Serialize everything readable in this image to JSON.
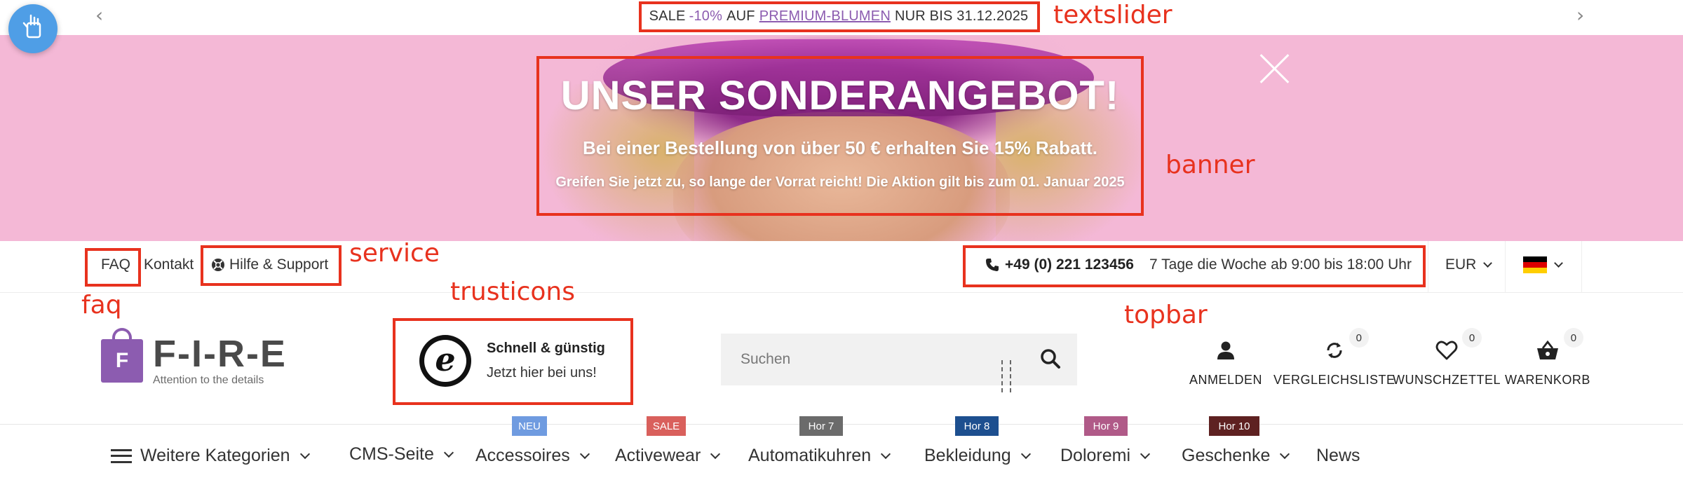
{
  "textslider": {
    "sale": "SALE",
    "percent": "-10%",
    "auf": "AUF",
    "link": "PREMIUM-BLUMEN",
    "suffix": "NUR BIS 31.12.2025"
  },
  "banner": {
    "title": "UNSER SONDERANGEBOT!",
    "subtitle": "Bei einer Bestellung von über 50 € erhalten Sie 15% Rabatt.",
    "note": "Greifen Sie jetzt zu, so lange der Vorrat reicht! Die Aktion gilt bis zum 01. Januar 2025"
  },
  "topbar": {
    "faq": "FAQ",
    "kontakt": "Kontakt",
    "support": "Hilfe & Support",
    "phone": "+49 (0) 221 123456",
    "hours": "7 Tage die Woche ab 9:00 bis 18:00 Uhr",
    "currency": "EUR"
  },
  "logo": {
    "letter": "F",
    "name": "F-I-R-E",
    "tagline": "Attention to the details"
  },
  "trust": {
    "title": "Schnell & günstig",
    "subtitle": "Jetzt hier bei uns!"
  },
  "search": {
    "placeholder": "Suchen"
  },
  "actions": {
    "login": "ANMELDEN",
    "compare": "VERGLEICHSLISTE",
    "compare_count": "0",
    "wishlist": "WUNSCHZETTEL",
    "wishlist_count": "0",
    "cart": "WARENKORB",
    "cart_count": "0"
  },
  "nav": {
    "more": "Weitere Kategorien",
    "cms": "CMS-Seite",
    "accessoires": "Accessoires",
    "activewear": "Activewear",
    "automatikuhren": "Automatikuhren",
    "bekleidung": "Bekleidung",
    "doloremi": "Doloremi",
    "geschenke": "Geschenke",
    "news": "News",
    "badges": {
      "accessoires": "NEU",
      "activewear": "SALE",
      "automatikuhren": "Hor 7",
      "bekleidung": "Hor 8",
      "doloremi": "Hor 9",
      "geschenke": "Hor 10"
    },
    "badge_colors": {
      "accessoires": "#6f9be0",
      "activewear": "#d9605c",
      "automatikuhren": "#6b6b6b",
      "bekleidung": "#1d4f8f",
      "doloremi": "#b05a88",
      "geschenke": "#5e2121"
    }
  },
  "annotations": {
    "textslider": "textslider",
    "banner": "banner",
    "service": "service",
    "faq": "faq",
    "trusticons": "trusticons",
    "topbar": "topbar"
  },
  "colors": {
    "accent": "#8c5cb0",
    "annotation": "#e8321e",
    "fab": "#4f9ee6"
  }
}
